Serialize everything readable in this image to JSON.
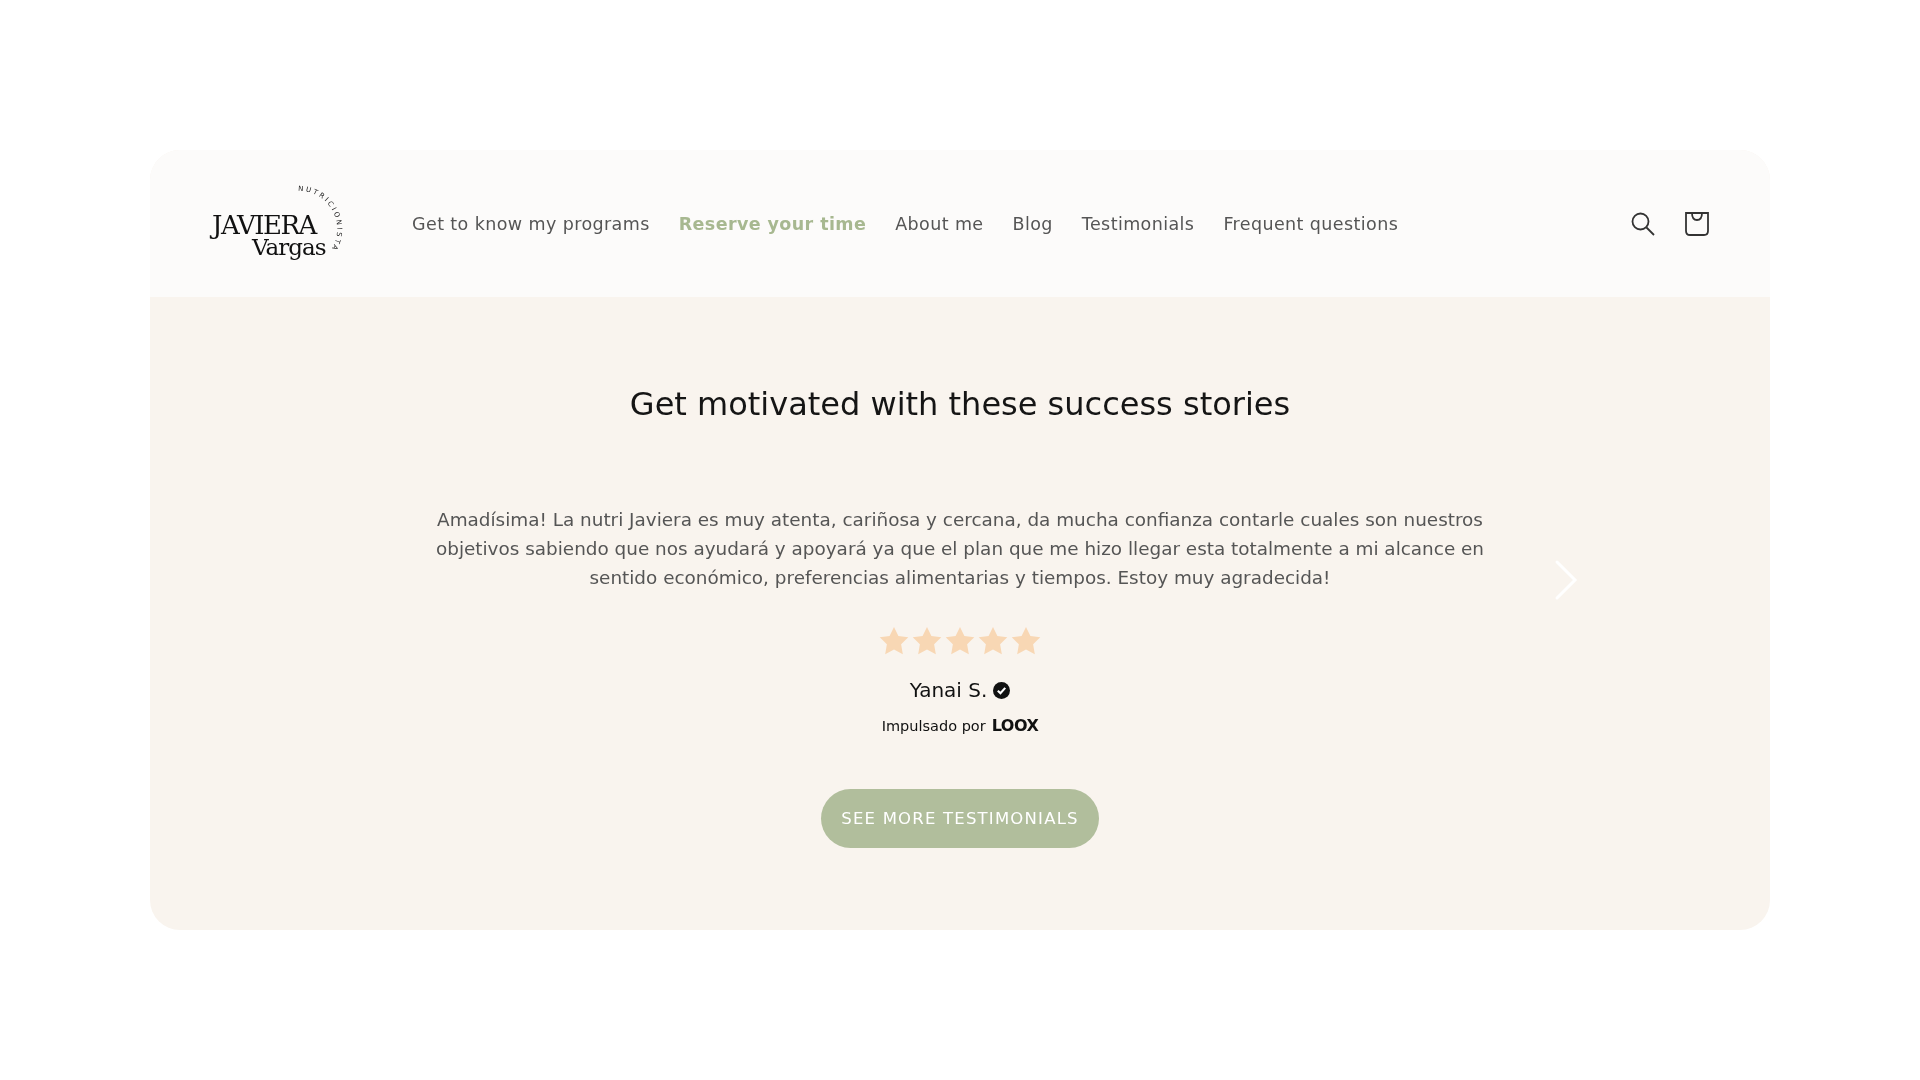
{
  "logo": {
    "name": "JAVIERA",
    "surname": "Vargas",
    "tagline": "NUTRICIONISTA"
  },
  "nav": [
    {
      "label": "Get to know my programs",
      "selected": false
    },
    {
      "label": "Reserve your time",
      "selected": true
    },
    {
      "label": "About me",
      "selected": false
    },
    {
      "label": "Blog",
      "selected": false
    },
    {
      "label": "Testimonials",
      "selected": false
    },
    {
      "label": "Frequent questions",
      "selected": false
    }
  ],
  "section": {
    "title": "Get motivated with these success stories",
    "review": {
      "text": "Amadísima! La nutri Javiera es muy atenta, cariñosa y cercana, da mucha confianza contarle cuales son nuestros objetivos sabiendo que nos ayudará y apoyará ya que el plan que me hizo llegar esta totalmente a mi alcance en sentido económico, preferencias alimentarias y tiempos. Estoy muy agradecida!",
      "stars": 5,
      "author": "Yanai S.",
      "verified": true
    },
    "powered_by": "Impulsado por",
    "powered_brand": "LOOX",
    "button": "SEE MORE TESTIMONIALS"
  }
}
